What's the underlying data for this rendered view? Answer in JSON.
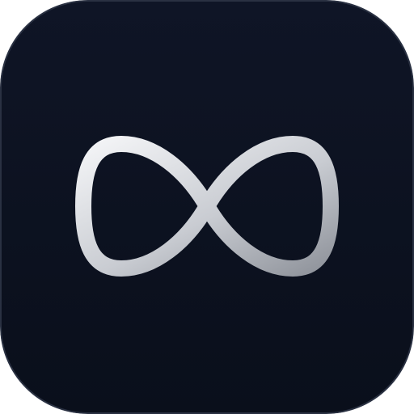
{
  "app_icon": {
    "glyph": "infinity-icon",
    "colors": {
      "background_top": "#0f1526",
      "background_bottom": "#0a0f1b",
      "rim": "#2a3142",
      "glyph_light": "#f4f5f7",
      "glyph_mid": "#c9ccd2",
      "glyph_dark": "#8f939b"
    }
  }
}
